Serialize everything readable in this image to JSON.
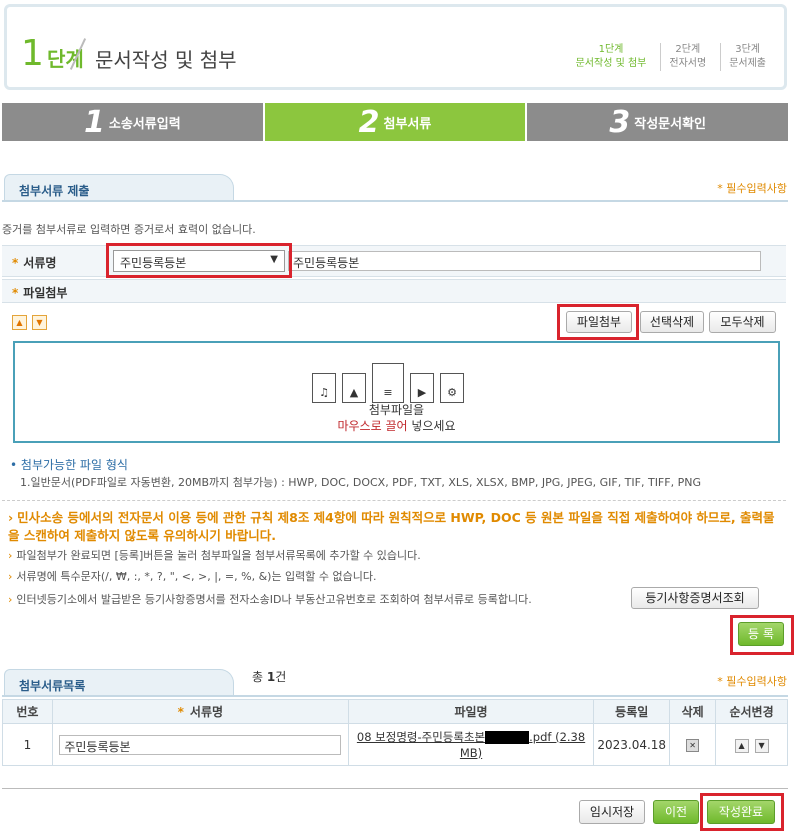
{
  "header": {
    "step_number": "1",
    "step_word": "단계",
    "title": "문서작성 및 첨부",
    "mini_steps": [
      {
        "line1": "1단계",
        "line2": "문서작성 및 첨부",
        "active": true
      },
      {
        "line1": "2단계",
        "line2": "전자서명",
        "active": false
      },
      {
        "line1": "3단계",
        "line2": "문서제출",
        "active": false
      }
    ]
  },
  "tabs": [
    {
      "num": "1",
      "label": "소송서류입력",
      "active": false
    },
    {
      "num": "2",
      "label": "첨부서류",
      "active": true
    },
    {
      "num": "3",
      "label": "작성문서확인",
      "active": false
    }
  ],
  "submit_section": {
    "title": "첨부서류 제출",
    "required_note": "* 필수입력사항",
    "warning": "증거를 첨부서류로 입력하면 증거로서 효력이 없습니다.",
    "doc_label": "서류명",
    "doc_select_value": "주민등록등본",
    "doc_name_value": "주민등록등본",
    "file_label": "파일첨부",
    "up_icon": "arrow-up-icon",
    "down_icon": "arrow-down-icon",
    "btn_attach": "파일첨부",
    "btn_delete_selected": "선택삭제",
    "btn_delete_all": "모두삭제",
    "drop_line1": "첨부파일을",
    "drop_line2_red": "마우스로 끌어",
    "drop_line2_rest": " 넣으세요",
    "formats_title": "첨부가능한 파일 형식",
    "formats_desc": "1.일반문서(PDF파일로 자동변환, 20MB까지 첨부가능) : HWP, DOC, DOCX, PDF, TXT, XLS, XLSX, BMP, JPG, JPEG, GIF, TIF, TIFF, PNG",
    "notice_bold": "민사소송 등에서의 전자문서 이용 등에 관한 규칙 제8조 제4항에 따라 원칙적으로 HWP, DOC 등 원본 파일을 직접 제출하여야 하므로, 출력물을 스캔하여 제출하지 않도록 유의하시기 바랍니다.",
    "notice1": "파일첨부가 완료되면 [등록]버튼을 눌러 첨부파일을 첨부서류목록에 추가할 수 있습니다.",
    "notice2": "서류명에 특수문자(/, ₩, :, *, ?, \", <, >, |, =, %, &)는 입력할 수 없습니다.",
    "notice3": "인터넷등기소에서 발급받은 등기사항증명서를 전자소송ID나 부동산고유번호로 조회하여 첨부서류로 등록합니다.",
    "btn_lookup": "등기사항증명서조회",
    "btn_register": "등 록"
  },
  "list_section": {
    "title": "첨부서류목록",
    "count_prefix": "총 ",
    "count_num": "1",
    "count_suffix": "건",
    "required_note": "* 필수입력사항",
    "columns": [
      "번호",
      "서류명",
      "파일명",
      "등록일",
      "삭제",
      "순서변경"
    ],
    "rows": [
      {
        "no": "1",
        "doc_name": "주민등록등본",
        "file_prefix": "08 보정명령-주민등록초본",
        "file_suffix": ".pdf (2.38",
        "file_size_tail": "MB)",
        "date": "2023.04.18"
      }
    ]
  },
  "footer": {
    "btn_temp_save": "임시저장",
    "btn_prev": "이전",
    "btn_complete": "작성완료"
  }
}
